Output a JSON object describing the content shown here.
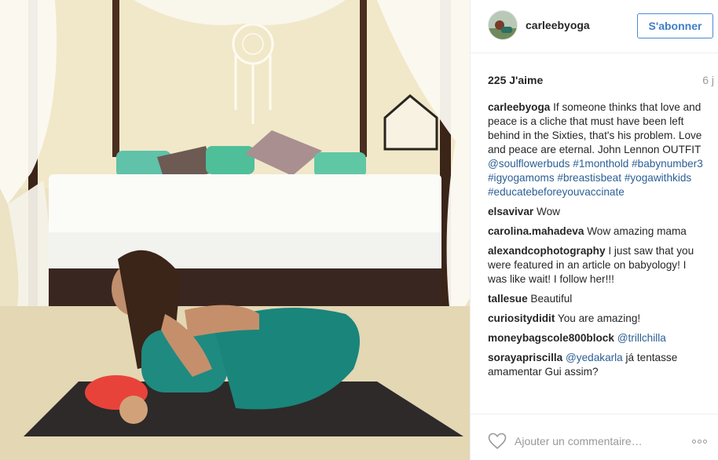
{
  "post": {
    "username": "carleebyoga",
    "follow_label": "S'abonner",
    "likes": "225 J'aime",
    "age": "6 j"
  },
  "caption": {
    "author": "carleebyoga",
    "text": "If someone thinks that love and peace is a cliche that must have been left behind in the Sixties, that's his problem. Love and peace are eternal. John Lennon OUTFIT",
    "tags": [
      "@soulflowerbuds",
      "#1monthold",
      "#babynumber3",
      "#igyogamoms",
      "#breastisbeat",
      "#yogawithkids",
      "#educatebeforeyouvaccinate"
    ]
  },
  "comments": [
    {
      "author": "elsavivar",
      "text": "Wow",
      "tag": ""
    },
    {
      "author": "carolina.mahadeva",
      "text": "Wow amazing mama",
      "tag": ""
    },
    {
      "author": "alexandcophotography",
      "text": "I just saw that you were featured in an article on babyology! I was like wait! I follow her!!!",
      "tag": ""
    },
    {
      "author": "tallesue",
      "text": "Beautiful",
      "tag": ""
    },
    {
      "author": "curiositydidit",
      "text": "You are amazing!",
      "tag": ""
    },
    {
      "author": "moneybagscole800block",
      "text": "",
      "tag": "@trillchilla"
    },
    {
      "author": "sorayapriscilla",
      "text": "já tentasse amamentar Gui assim?",
      "tag": "@yedakarla"
    }
  ],
  "footer": {
    "heart_icon": "heart-outline-icon",
    "comment_placeholder": "Ajouter un commentaire…",
    "more_icon": "more-options-icon"
  },
  "colors": {
    "link": "#2b5f95",
    "follow_border": "#4c8ad0",
    "muted": "#999999"
  }
}
